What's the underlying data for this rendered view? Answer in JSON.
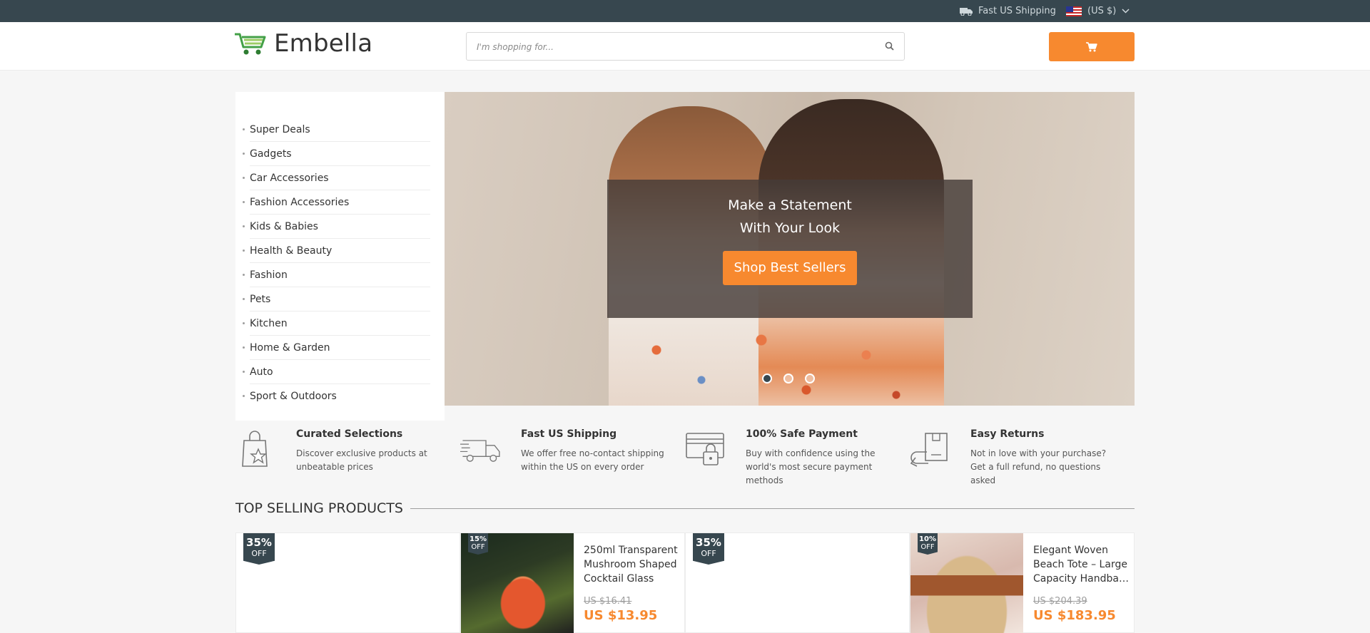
{
  "topbar": {
    "shipping_label": "Fast US Shipping",
    "currency_label": "(US $)"
  },
  "header": {
    "logo_text": "Embella",
    "search_placeholder": "I'm shopping for..."
  },
  "sidebar": {
    "items": [
      {
        "label": "Super Deals"
      },
      {
        "label": "Gadgets"
      },
      {
        "label": "Car Accessories"
      },
      {
        "label": "Fashion Accessories"
      },
      {
        "label": "Kids & Babies"
      },
      {
        "label": "Health & Beauty"
      },
      {
        "label": "Fashion"
      },
      {
        "label": "Pets"
      },
      {
        "label": "Kitchen"
      },
      {
        "label": "Home & Garden"
      },
      {
        "label": "Auto"
      },
      {
        "label": "Sport & Outdoors"
      }
    ]
  },
  "hero": {
    "headline_line1": "Make a Statement",
    "headline_line2": "With Your Look",
    "cta_label": "Shop Best Sellers",
    "slide_count": 3,
    "active_slide": 1
  },
  "features": [
    {
      "icon": "shopping-bag-star-icon",
      "title": "Curated Selections",
      "desc": "Discover exclusive products at unbeatable prices"
    },
    {
      "icon": "delivery-truck-icon",
      "title": "Fast US Shipping",
      "desc": "We offer free no-contact shipping within the US on every order"
    },
    {
      "icon": "secure-card-lock-icon",
      "title": "100% Safe Payment",
      "desc": "Buy with confidence using the world's most secure payment methods"
    },
    {
      "icon": "return-box-icon",
      "title": "Easy Returns",
      "desc": "Not in love with your purchase? Get a full refund, no questions asked"
    }
  ],
  "section": {
    "top_selling_title": "TOP SELLING PRODUCTS"
  },
  "products": [
    {
      "discount_pct": "35%",
      "discount_off": "OFF",
      "title": "",
      "old_price": "",
      "new_price": ""
    },
    {
      "discount_pct": "15%",
      "discount_off": "OFF",
      "title": "250ml Transparent Mushroom Shaped Cocktail Glass",
      "old_price": "US $16.41",
      "new_price": "US $13.95"
    },
    {
      "discount_pct": "35%",
      "discount_off": "OFF",
      "title": "",
      "old_price": "",
      "new_price": ""
    },
    {
      "discount_pct": "10%",
      "discount_off": "OFF",
      "title": "Elegant Woven Beach Tote – Large Capacity Handbag for Women",
      "old_price": "US $204.39",
      "new_price": "US $183.95"
    }
  ],
  "colors": {
    "topbar_bg": "#37474f",
    "accent_orange": "#f7892f",
    "logo_green": "#43a047"
  }
}
